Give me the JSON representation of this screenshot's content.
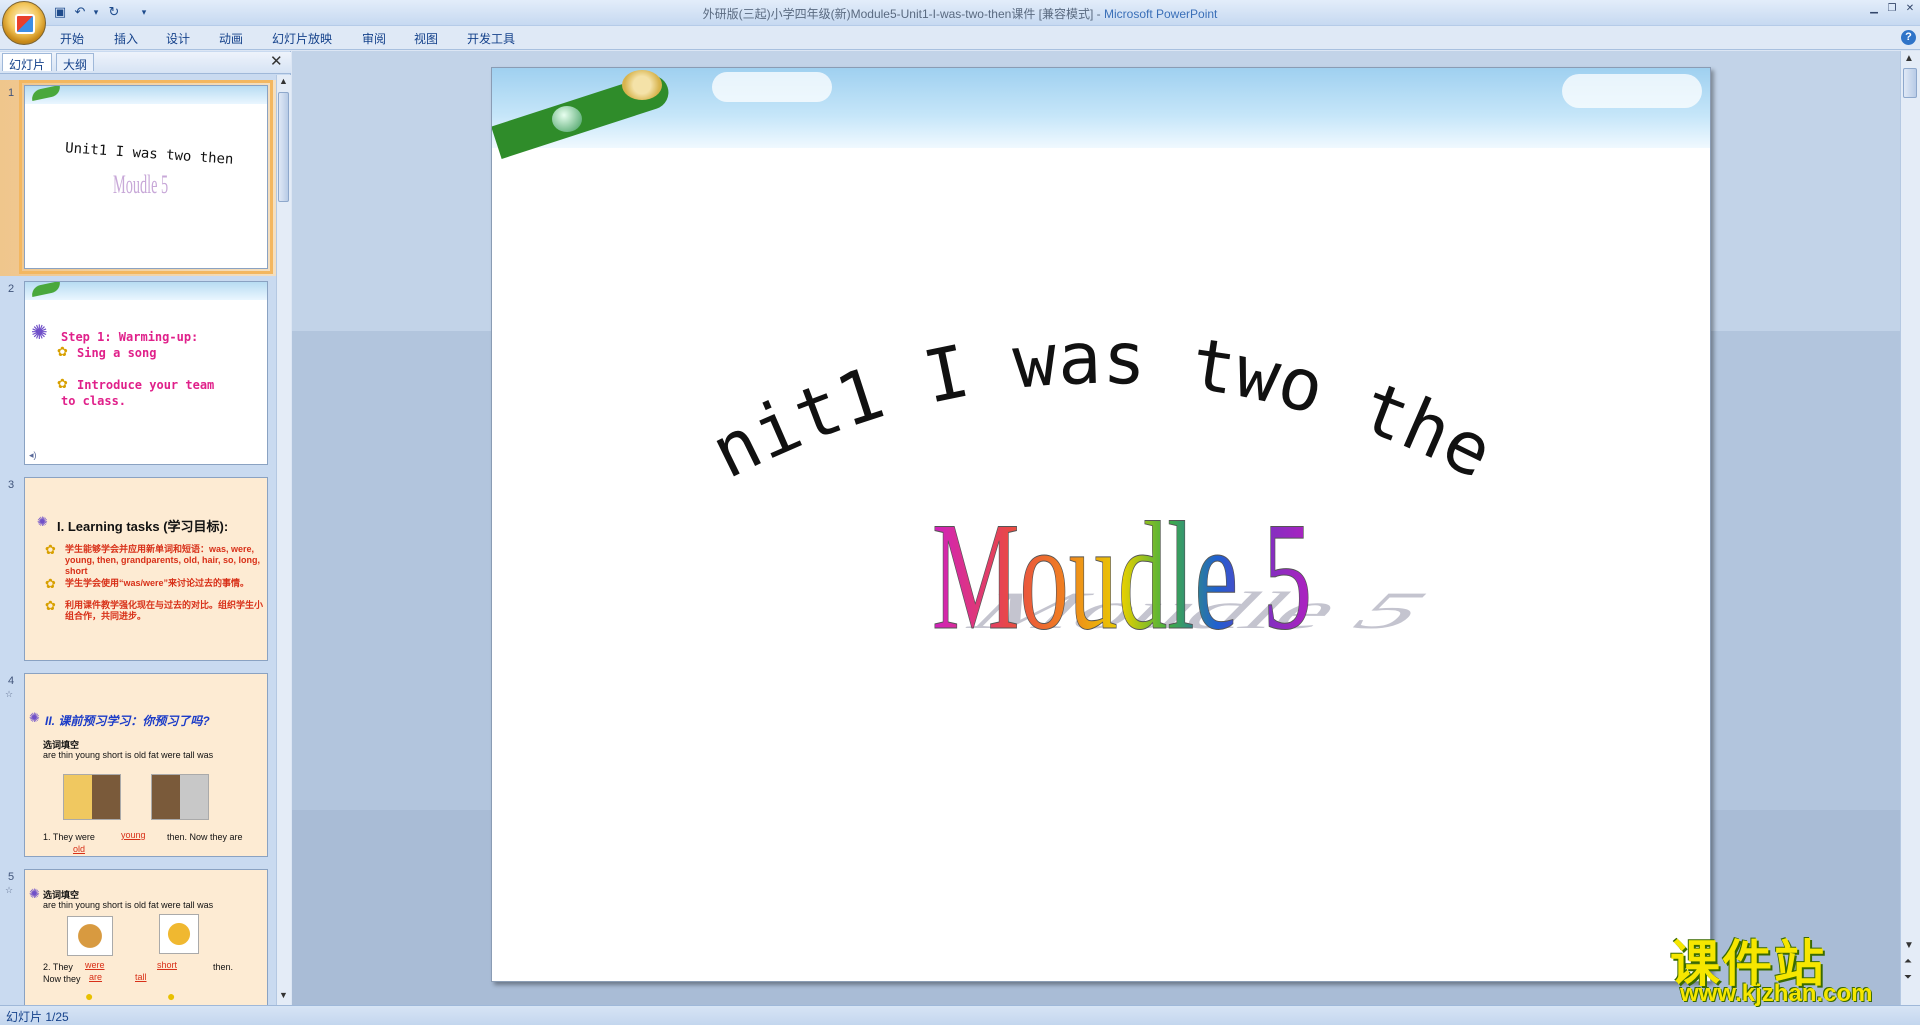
{
  "window": {
    "title_main": "外研版(三起)小学四年级(新)Module5-Unit1-I-was-two-then课件 [兼容模式] - ",
    "title_app": "Microsoft PowerPoint"
  },
  "quick_access": {
    "save_icon": "save-icon",
    "undo_icon": "undo-icon",
    "redo_icon": "redo-icon",
    "customize_icon": "dropdown-icon"
  },
  "ribbon": {
    "tabs": [
      {
        "label": "开始"
      },
      {
        "label": "插入"
      },
      {
        "label": "设计"
      },
      {
        "label": "动画"
      },
      {
        "label": "幻灯片放映"
      },
      {
        "label": "审阅"
      },
      {
        "label": "视图"
      },
      {
        "label": "开发工具"
      }
    ],
    "help": "?"
  },
  "panel": {
    "tabs": [
      {
        "label": "幻灯片"
      },
      {
        "label": "大纲"
      }
    ],
    "close": "✕"
  },
  "thumbnails": {
    "s1": {
      "num": "1",
      "line1": "Unit1 I was two then",
      "line2": "Moudle 5"
    },
    "s2": {
      "num": "2",
      "step": "Step 1: Warming-up:",
      "sing": "Sing a song",
      "intro1": "Introduce your team",
      "intro2": "to class."
    },
    "s3": {
      "num": "3",
      "heading": "I. Learning tasks (学习目标):",
      "b1": "学生能够学会并应用新单词和短语：was, were, young, then, grandparents, old, hair, so, long, short",
      "b2": "学生学会使用“was/were”来讨论过去的事情。",
      "b3": "利用课件教学强化现在与过去的对比。组织学生小组合作，共同进步。"
    },
    "s4": {
      "num": "4",
      "heading": "II. 课前预习学习：",
      "heading_em": "你预习了吗?",
      "sub": "选词填空",
      "words": "are thin young short is old fat     were tall was",
      "q1": "1. They were",
      "a1": "young",
      "q1b": "then. Now they are",
      "a1b": "old"
    },
    "s5": {
      "num": "5",
      "sub": "选词填空",
      "words": "are thin young short is old fat     were tall was",
      "q2": "2. They",
      "a2": "were",
      "a2b": "short",
      "q2b": "then.",
      "q2c": "Now they",
      "a2c": "are",
      "a2d": "tall"
    }
  },
  "slide": {
    "title": "Unit1 I was two then",
    "subtitle": "Moudle 5"
  },
  "status": {
    "text": "幻灯片 1/25"
  },
  "watermark": {
    "cn": "课件站",
    "url": "www.kjzhan.com"
  }
}
